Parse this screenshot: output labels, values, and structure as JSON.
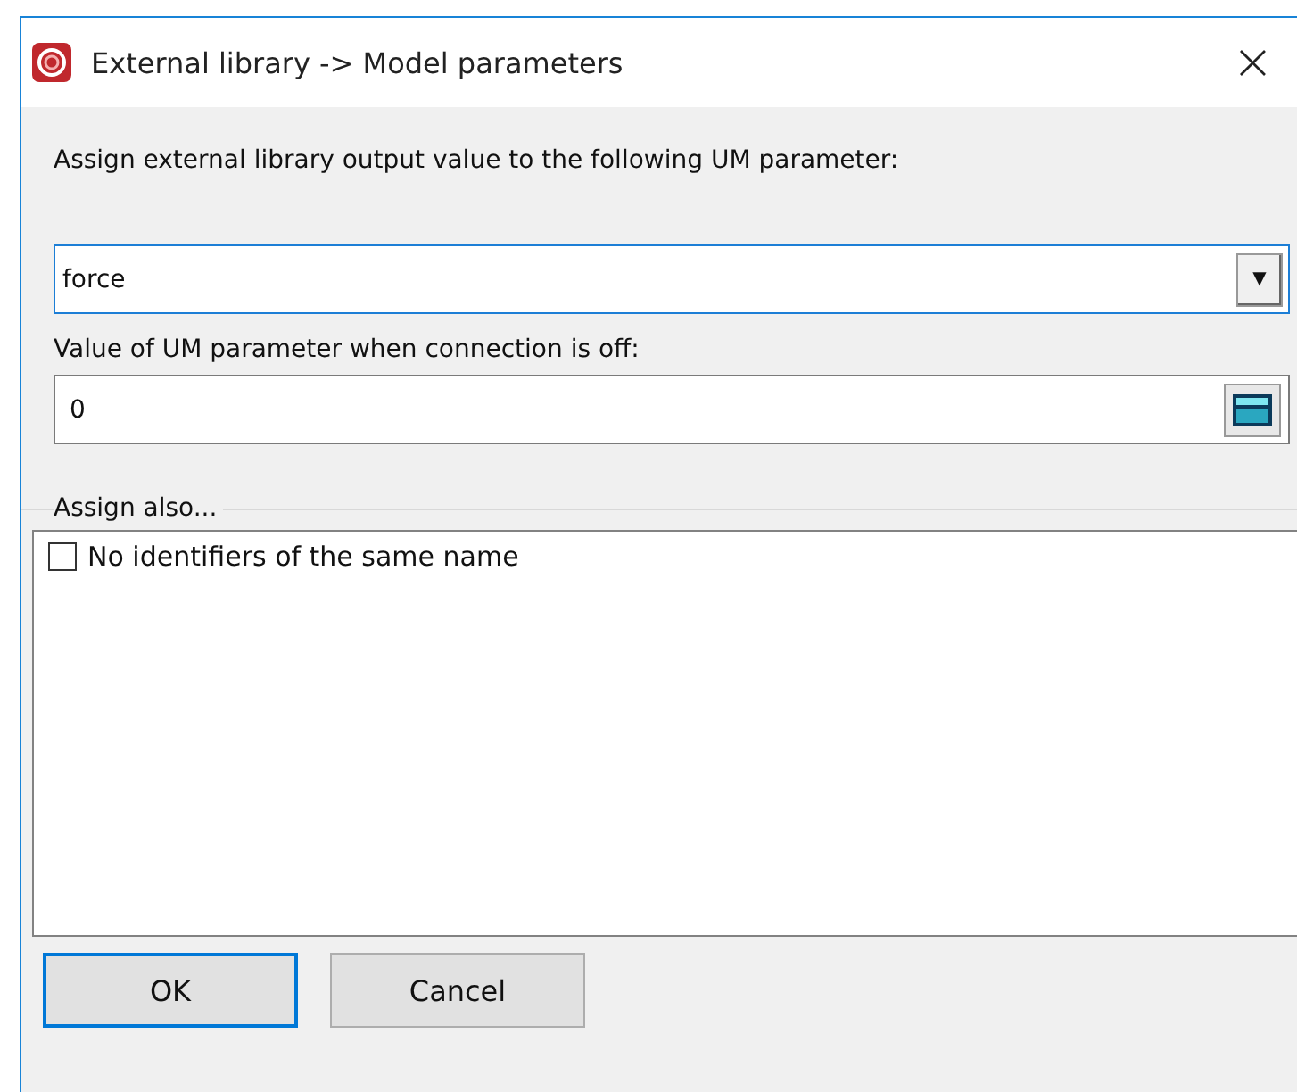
{
  "window": {
    "title": "External library -> Model parameters",
    "close": "×"
  },
  "output_label": "Assign external library output value to the following UM parameter:",
  "parameter_combo": {
    "value": "force",
    "arrow": "▼"
  },
  "off_label": "Value of UM parameter when connection is off:",
  "off_value": {
    "value": "0"
  },
  "assign_also": {
    "title": "Assign also...",
    "items": [
      {
        "label": "No identifiers of the same name",
        "checked": false
      }
    ]
  },
  "buttons": [
    {
      "label": "OK",
      "default": true
    },
    {
      "label": "Cancel",
      "default": false
    }
  ]
}
